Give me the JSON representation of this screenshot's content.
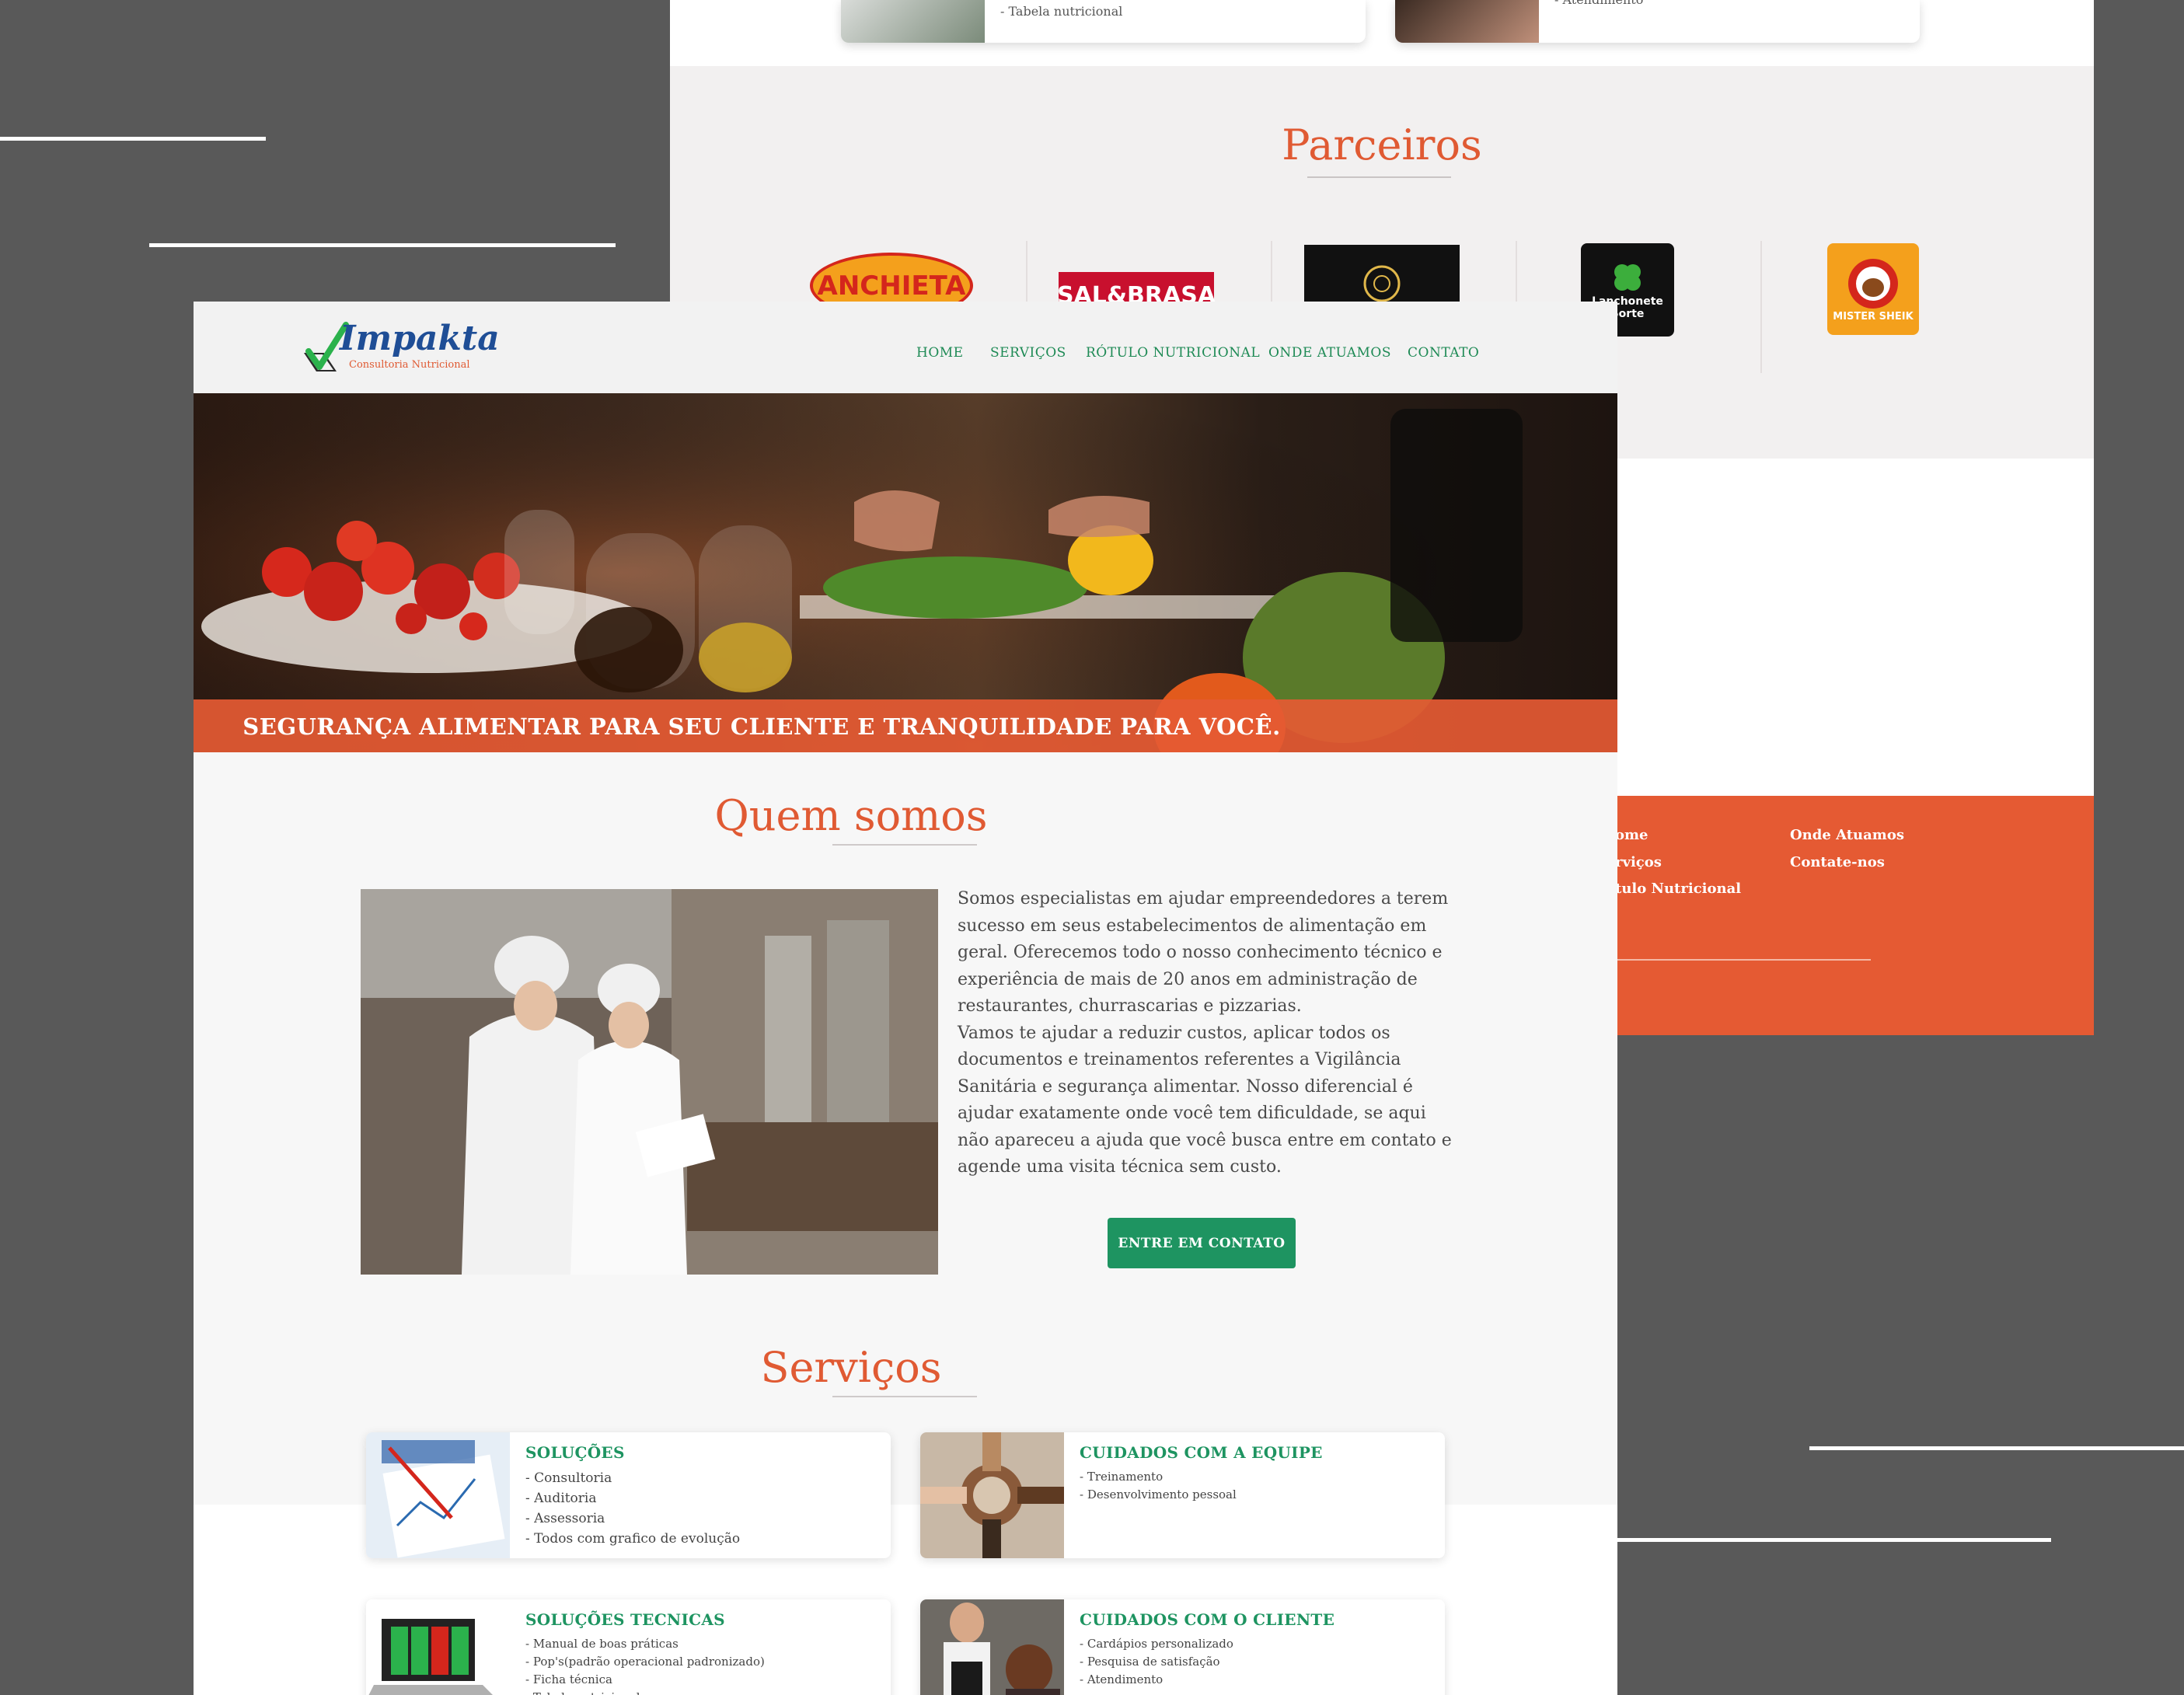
{
  "back_page": {
    "top_cards": [
      {
        "items": [
          "- Tabela nutricional"
        ]
      },
      {
        "items": [
          "- Atendimento"
        ]
      }
    ],
    "partners": {
      "title": "Parceiros",
      "logos": [
        {
          "name": "ANCHIETA",
          "color": "#d4261c"
        },
        {
          "name": "SAL&BRASA",
          "color": "#c8102e"
        },
        {
          "name": "",
          "color": "#111111"
        },
        {
          "name": "Lanchonete Sorte",
          "color": "#111111"
        },
        {
          "name": "MISTER SHEIK",
          "color": "#f4a01c"
        }
      ]
    },
    "footer": {
      "links_col1": [
        "ome",
        "rviços",
        "tulo Nutricional"
      ],
      "links_col2": [
        "Onde Atuamos",
        "Contate-nos"
      ]
    }
  },
  "header": {
    "logo_brand": "Impakta",
    "logo_subtitle": "Consultoria Nutricional",
    "nav": [
      "HOME",
      "SERVIÇOS",
      "RÓTULO NUTRICIONAL",
      "ONDE ATUAMOS",
      "CONTATO"
    ]
  },
  "hero": {
    "tagline": "SEGURANÇA ALIMENTAR PARA SEU CLIENTE E TRANQUILIDADE PARA VOCÊ."
  },
  "about": {
    "title": "Quem somos",
    "paragraph1": "Somos especialistas em ajudar empreendedores a terem sucesso em seus estabelecimentos de alimentação em geral. Oferecemos todo o nosso conhecimento técnico e experiência de mais de 20 anos em administração de restaurantes, churrascarias e pizzarias.",
    "paragraph2": "Vamos te ajudar a reduzir custos, aplicar todos os documentos e treinamentos referentes a Vigilância Sanitária e segurança alimentar. Nosso diferencial é ajudar exatamente onde você tem dificuldade, se aqui não apareceu a ajuda que você busca entre em contato e agende uma visita técnica sem custo.",
    "cta": "ENTRE EM CONTATO"
  },
  "services": {
    "title": "Serviços",
    "cards": [
      {
        "title": "SOLUÇÕES",
        "items": [
          "- Consultoria",
          "- Auditoria",
          "- Assessoria",
          "- Todos com grafico de evolução"
        ]
      },
      {
        "title": "CUIDADOS COM A EQUIPE",
        "items": [
          "- Treinamento",
          "- Desenvolvimento pessoal"
        ]
      },
      {
        "title": "SOLUÇÕES TECNICAS",
        "items": [
          "- Manual de boas práticas",
          "- Pop's(padrão operacional padronizado)",
          "- Ficha técnica",
          "- Tabela nutricional"
        ]
      },
      {
        "title": "CUIDADOS COM O CLIENTE",
        "items": [
          "- Cardápios personalizado",
          "- Pesquisa de satisfação",
          "- Atendimento"
        ]
      }
    ]
  },
  "colors": {
    "accent_orange": "#e55a33",
    "accent_green": "#1e9461",
    "background": "#595959"
  },
  "icons": [
    "whatsapp-icon",
    "checkmark-logo-icon"
  ]
}
